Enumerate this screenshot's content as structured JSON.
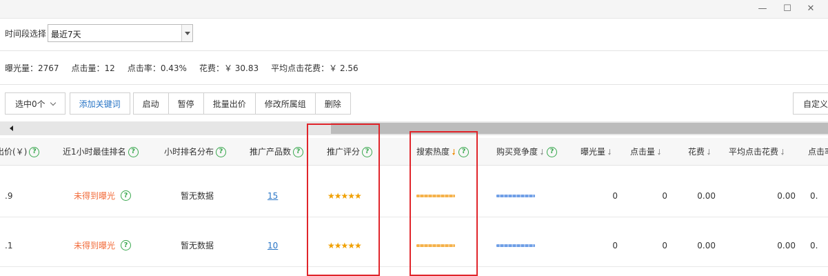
{
  "window": {
    "minimize": "—",
    "maximize": "☐",
    "close": "✕"
  },
  "period": {
    "label": "时间段选择",
    "value": "最近7天"
  },
  "stats": [
    "曝光量：2767",
    "点击量：12",
    "点击率：0.43%",
    "花费：￥ 30.83",
    "平均点击花费：￥ 2.56"
  ],
  "toolbar": {
    "select_label": "选中0个",
    "add_keyword": "添加关键词",
    "start": "启动",
    "pause": "暂停",
    "batch_bid": "批量出价",
    "change_group": "修改所属组",
    "delete": "删除",
    "custom": "自定义"
  },
  "table": {
    "headers": {
      "price": "出价(￥)",
      "best_rank": "近1小时最佳排名",
      "hour_rank": "小时排名分布",
      "product_count": "推广产品数",
      "promo_score": "推广评分",
      "search_heat": "搜索热度",
      "competition": "购买竞争度",
      "exposure": "曝光量",
      "clicks": "点击量",
      "cost": "花费",
      "avg_cost": "平均点击花费",
      "ctr": "点击率"
    },
    "rows": [
      {
        "price": ".9",
        "best_rank": "未得到曝光",
        "hour_rank": "暂无数据",
        "product_count": "15",
        "promo_score": "★★★★★",
        "exposure": "0",
        "clicks": "0",
        "cost": "0.00",
        "avg_cost": "0.00",
        "ctr": "0."
      },
      {
        "price": ".1",
        "best_rank": "未得到曝光",
        "hour_rank": "暂无数据",
        "product_count": "10",
        "promo_score": "★★★★★",
        "exposure": "0",
        "clicks": "0",
        "cost": "0.00",
        "avg_cost": "0.00",
        "ctr": "0."
      }
    ]
  },
  "colors": {
    "accent": "#2a76c6",
    "help": "#3aa84f",
    "warn": "#f26b3a",
    "highlight": "#e0242a"
  }
}
